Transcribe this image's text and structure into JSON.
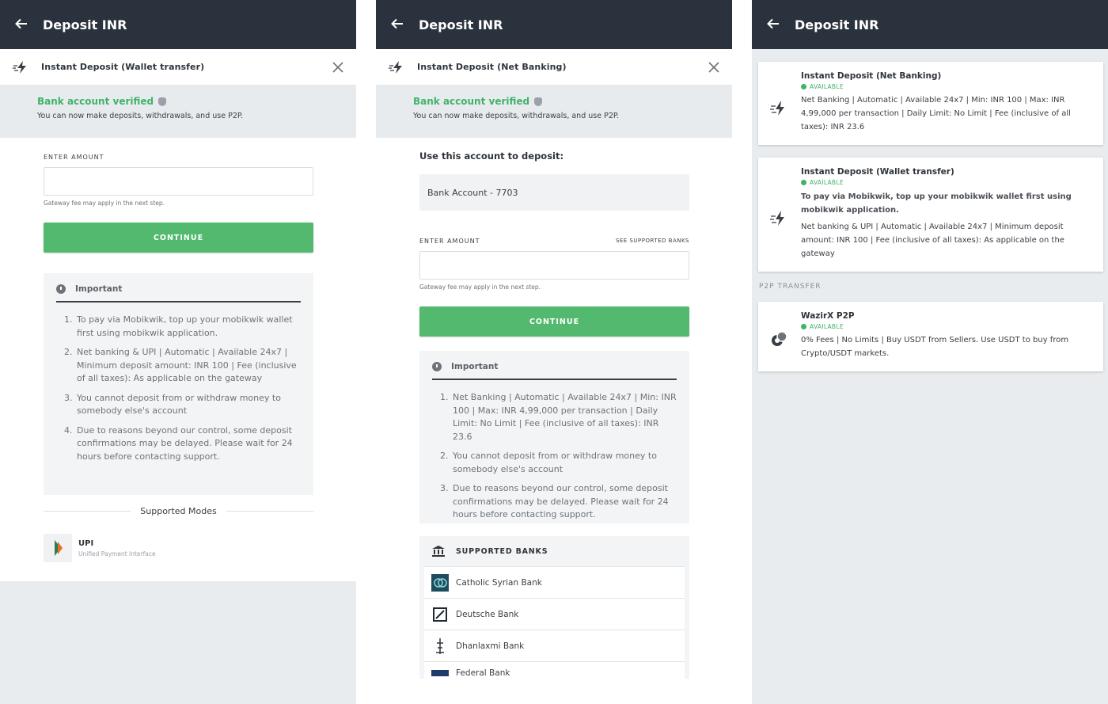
{
  "header": {
    "title": "Deposit INR"
  },
  "panel1": {
    "mode_title": "Instant Deposit (Wallet transfer)",
    "verified_title": "Bank account verified",
    "verified_sub": "You can now make deposits, withdrawals, and use P2P.",
    "amount_label": "ENTER AMOUNT",
    "amount_value": "",
    "gateway_note": "Gateway fee may apply in the next step.",
    "continue_label": "CONTINUE",
    "important_title": "Important",
    "important_items": [
      "To pay via Mobikwik, top up your mobikwik wallet first using mobikwik application.",
      "Net banking & UPI | Automatic | Available 24x7 | Minimum deposit amount: INR 100 | Fee (inclusive of all taxes): As applicable on the gateway",
      "You cannot deposit from or withdraw money to somebody else's account",
      "Due to reasons beyond our control, some deposit confirmations may be delayed. Please wait for 24 hours before contacting support."
    ],
    "supported_modes": "Supported Modes",
    "upi_name": "UPI",
    "upi_sub": "Unified Payment Interface"
  },
  "panel2": {
    "mode_title": "Instant Deposit (Net Banking)",
    "verified_title": "Bank account verified",
    "verified_sub": "You can now make deposits, withdrawals, and use P2P.",
    "use_account_label": "Use this account to deposit:",
    "account_value": "Bank Account - 7703",
    "amount_label": "ENTER AMOUNT",
    "see_banks": "SEE SUPPORTED BANKS",
    "amount_value": "",
    "gateway_note": "Gateway fee may apply in the next step.",
    "continue_label": "CONTINUE",
    "important_title": "Important",
    "important_items": [
      "Net Banking | Automatic | Available 24x7 | Min: INR 100 | Max: INR 4,99,000 per transaction | Daily Limit: No Limit | Fee (inclusive of all taxes): INR 23.6",
      "You cannot deposit from or withdraw money to somebody else's account",
      "Due to reasons beyond our control, some deposit confirmations may be delayed. Please wait for 24 hours before contacting support."
    ],
    "banks_title": "SUPPORTED BANKS",
    "banks": [
      "Catholic Syrian Bank",
      "Deutsche Bank",
      "Dhanlaxmi Bank",
      "Federal Bank"
    ]
  },
  "panel3": {
    "cards": [
      {
        "title": "Instant Deposit (Net Banking)",
        "status": "AVAILABLE",
        "note": "",
        "desc": "Net Banking | Automatic | Available 24x7 | Min: INR 100 | Max: INR 4,99,000 per transaction | Daily Limit: No Limit | Fee (inclusive of all taxes): INR 23.6"
      },
      {
        "title": "Instant Deposit (Wallet transfer)",
        "status": "AVAILABLE",
        "note": "To pay via Mobikwik, top up your mobikwik wallet first using mobikwik application.",
        "desc": "Net banking & UPI | Automatic | Available 24x7 | Minimum deposit amount: INR 100 | Fee (inclusive of all taxes): As applicable on the gateway"
      }
    ],
    "p2p_header": "P2P TRANSFER",
    "p2p_card": {
      "title": "WazirX P2P",
      "status": "AVAILABLE",
      "desc": "0% Fees | No Limits | Buy USDT from Sellers. Use USDT to buy from Crypto/USDT markets."
    }
  },
  "colors": {
    "topbar": "#2a323d",
    "accent_green": "#53b96e",
    "verified_green": "#3fb36a"
  },
  "icons": [
    "back-arrow-icon",
    "close-icon",
    "lightning-icon",
    "shield-icon",
    "info-icon",
    "upi-icon",
    "bank-icon",
    "p2p-icon"
  ]
}
